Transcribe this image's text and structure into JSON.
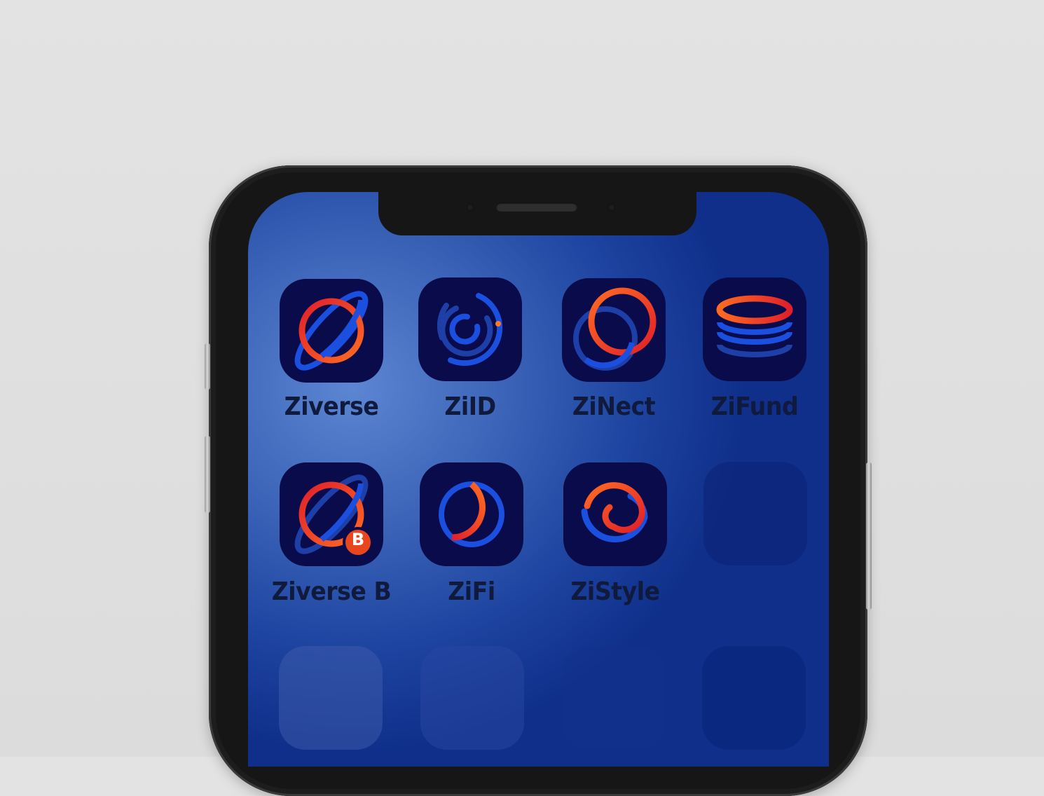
{
  "apps": [
    {
      "name": "Ziverse",
      "icon": "ziverse-planet-icon"
    },
    {
      "name": "ZiID",
      "icon": "ziid-fingerprint-icon"
    },
    {
      "name": "ZiNect",
      "icon": "zinect-rings-icon"
    },
    {
      "name": "ZiFund",
      "icon": "zifund-coin-stack-icon"
    },
    {
      "name": "Ziverse B",
      "icon": "ziverse-b-planet-icon",
      "badge": "B"
    },
    {
      "name": "ZiFi",
      "icon": "zifi-ring-icon"
    },
    {
      "name": "ZiStyle",
      "icon": "zistyle-spiral-icon"
    }
  ],
  "colors": {
    "icon_bg": "#0a0b4a",
    "orange": "#f0622a",
    "red": "#e0202a",
    "blue": "#1a4fe0",
    "label": "#0f1a3d"
  }
}
